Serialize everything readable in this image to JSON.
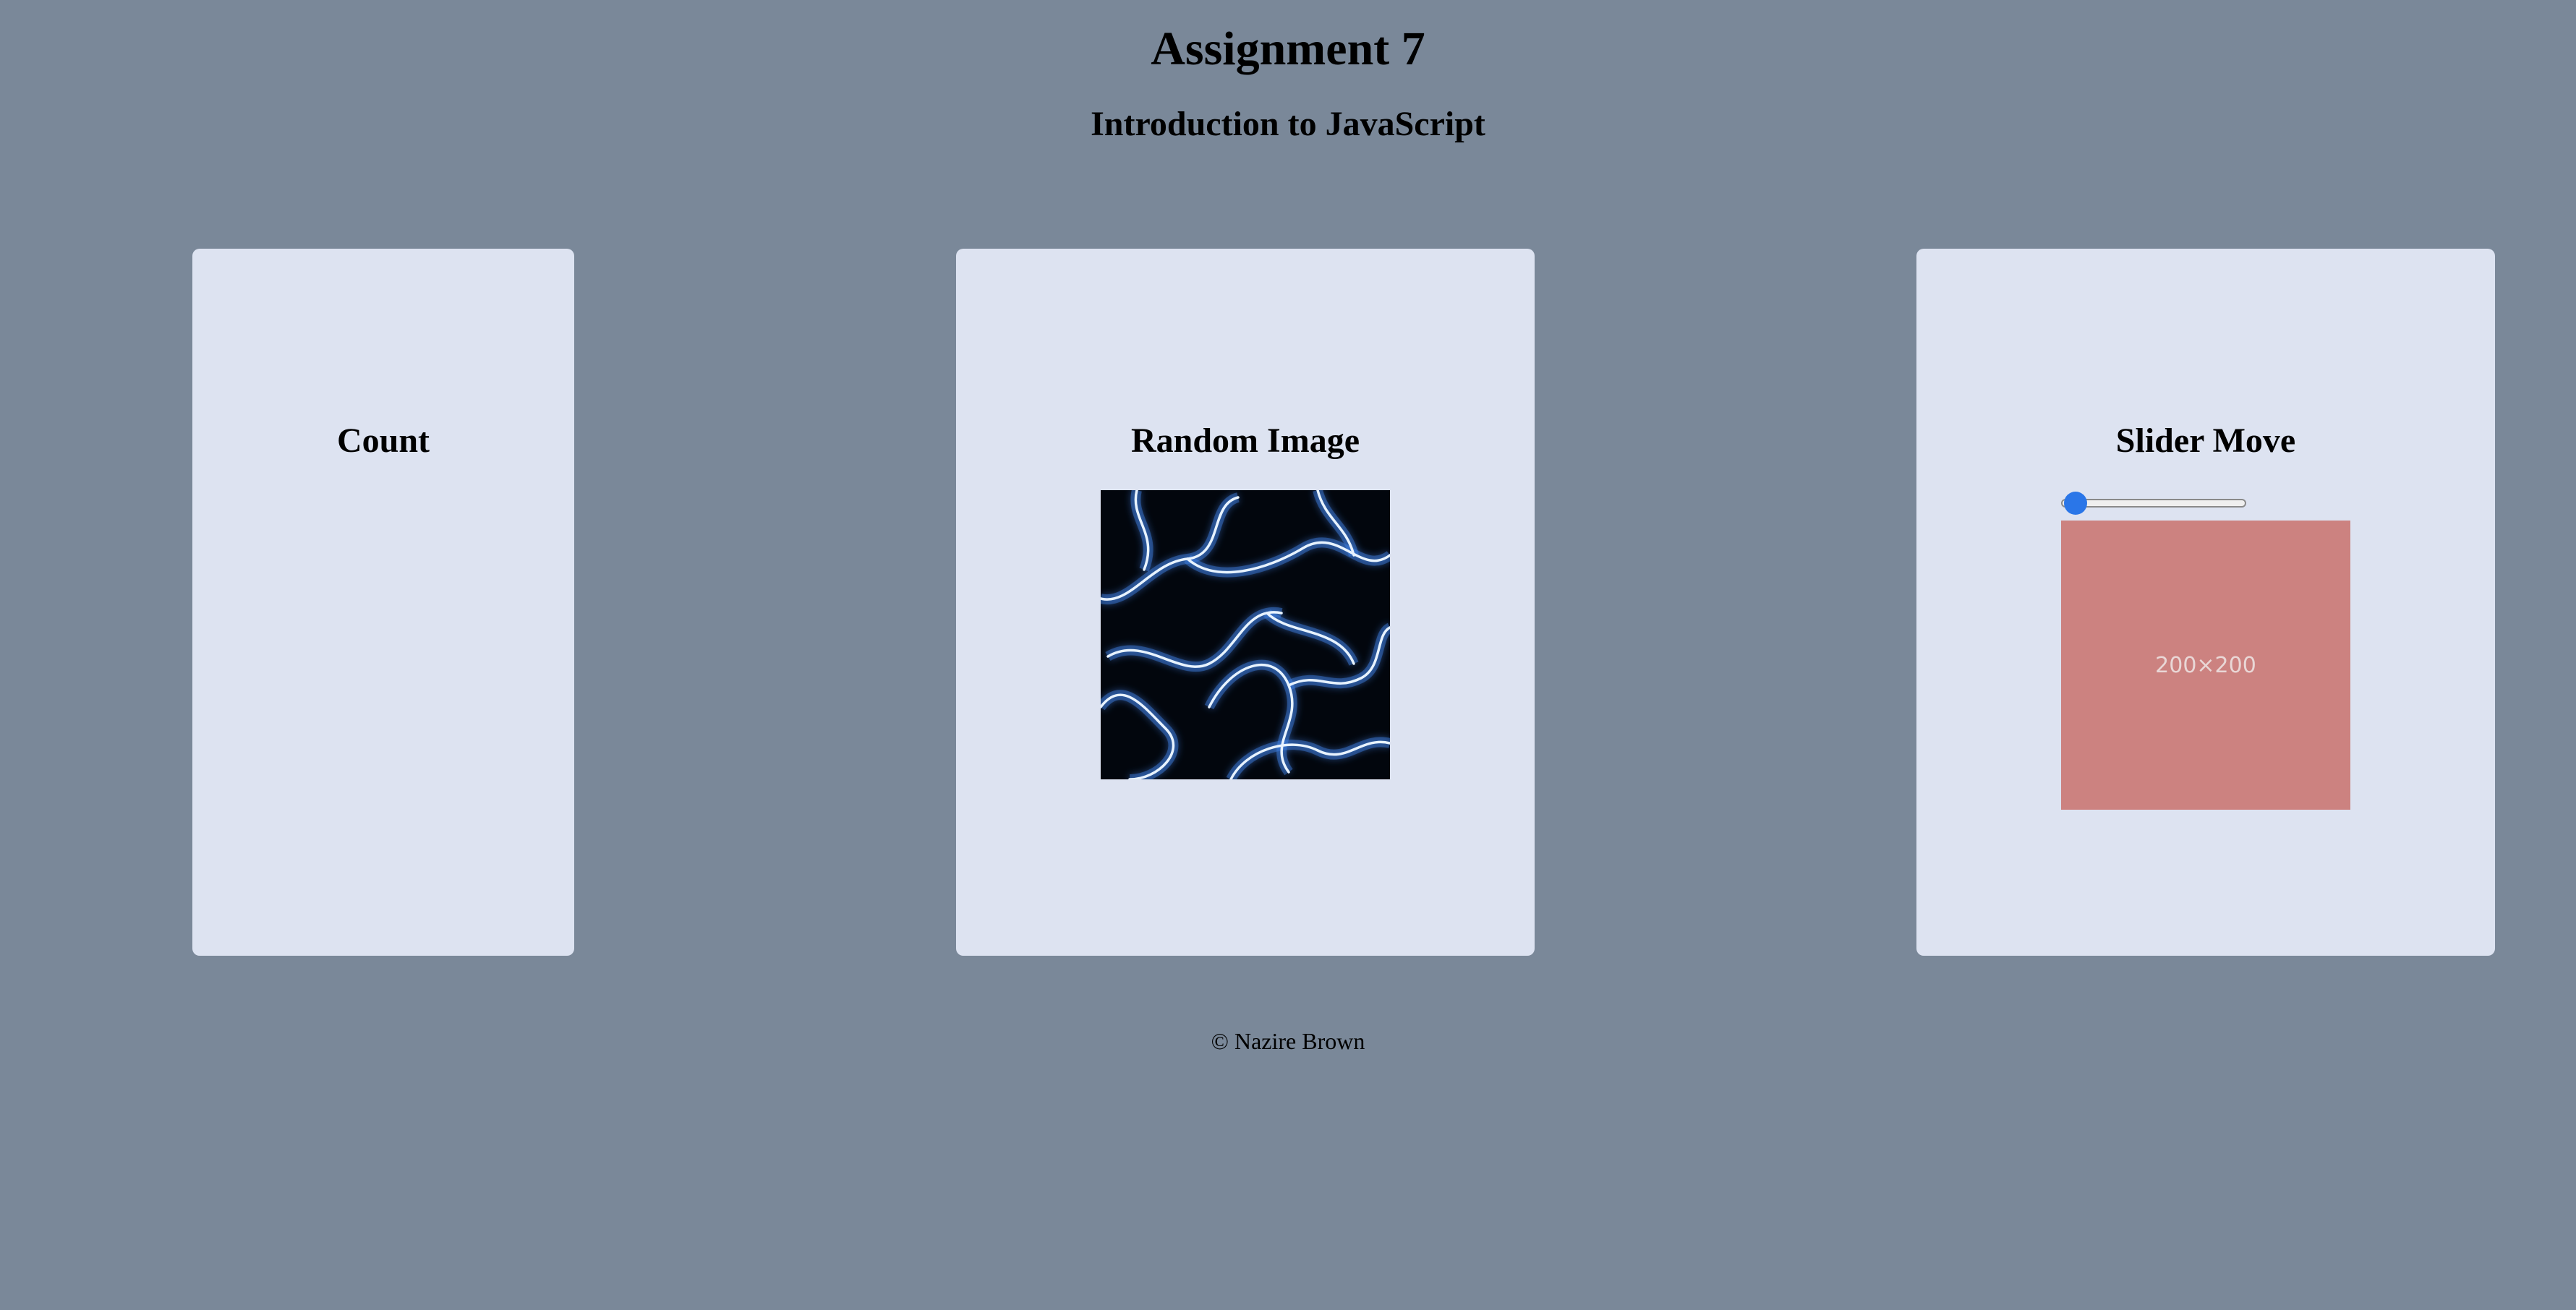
{
  "header": {
    "title": "Assignment 7",
    "subtitle": "Introduction to JavaScript"
  },
  "cards": {
    "count": {
      "heading": "Count"
    },
    "random_image": {
      "heading": "Random Image"
    },
    "slider_move": {
      "heading": "Slider Move",
      "slider_value_fraction": 0,
      "placeholder_text": "200×200"
    }
  },
  "footer": {
    "text": "© Nazire Brown"
  },
  "colors": {
    "background": "#7a8899",
    "card": "#dde3f1",
    "slider_thumb": "#2a76e8",
    "placeholder_box": "#cc8280"
  }
}
